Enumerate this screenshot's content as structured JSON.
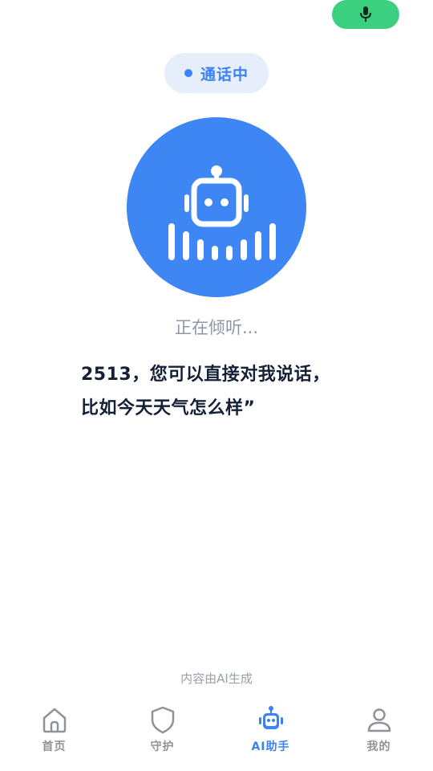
{
  "top": {
    "mic_icon": "microphone-icon",
    "mic_color": "#3ad07f"
  },
  "status": {
    "label": "通话中",
    "color": "#3b82f6"
  },
  "assistant": {
    "icon": "robot-voice-icon",
    "circle_color": "#3e86f3",
    "listening_text": "正在倾听..."
  },
  "prompt": {
    "line1": "2513，您可以直接对我说话，",
    "line2": "比如今天天气怎么样”"
  },
  "footer_note": "内容由AI生成",
  "tabbar": {
    "active_color": "#3b82f6",
    "items": [
      {
        "label": "首页",
        "icon": "home-icon"
      },
      {
        "label": "守护",
        "icon": "shield-icon"
      },
      {
        "label": "AI助手",
        "icon": "robot-icon"
      },
      {
        "label": "我的",
        "icon": "user-icon"
      }
    ],
    "active_index": 2
  }
}
